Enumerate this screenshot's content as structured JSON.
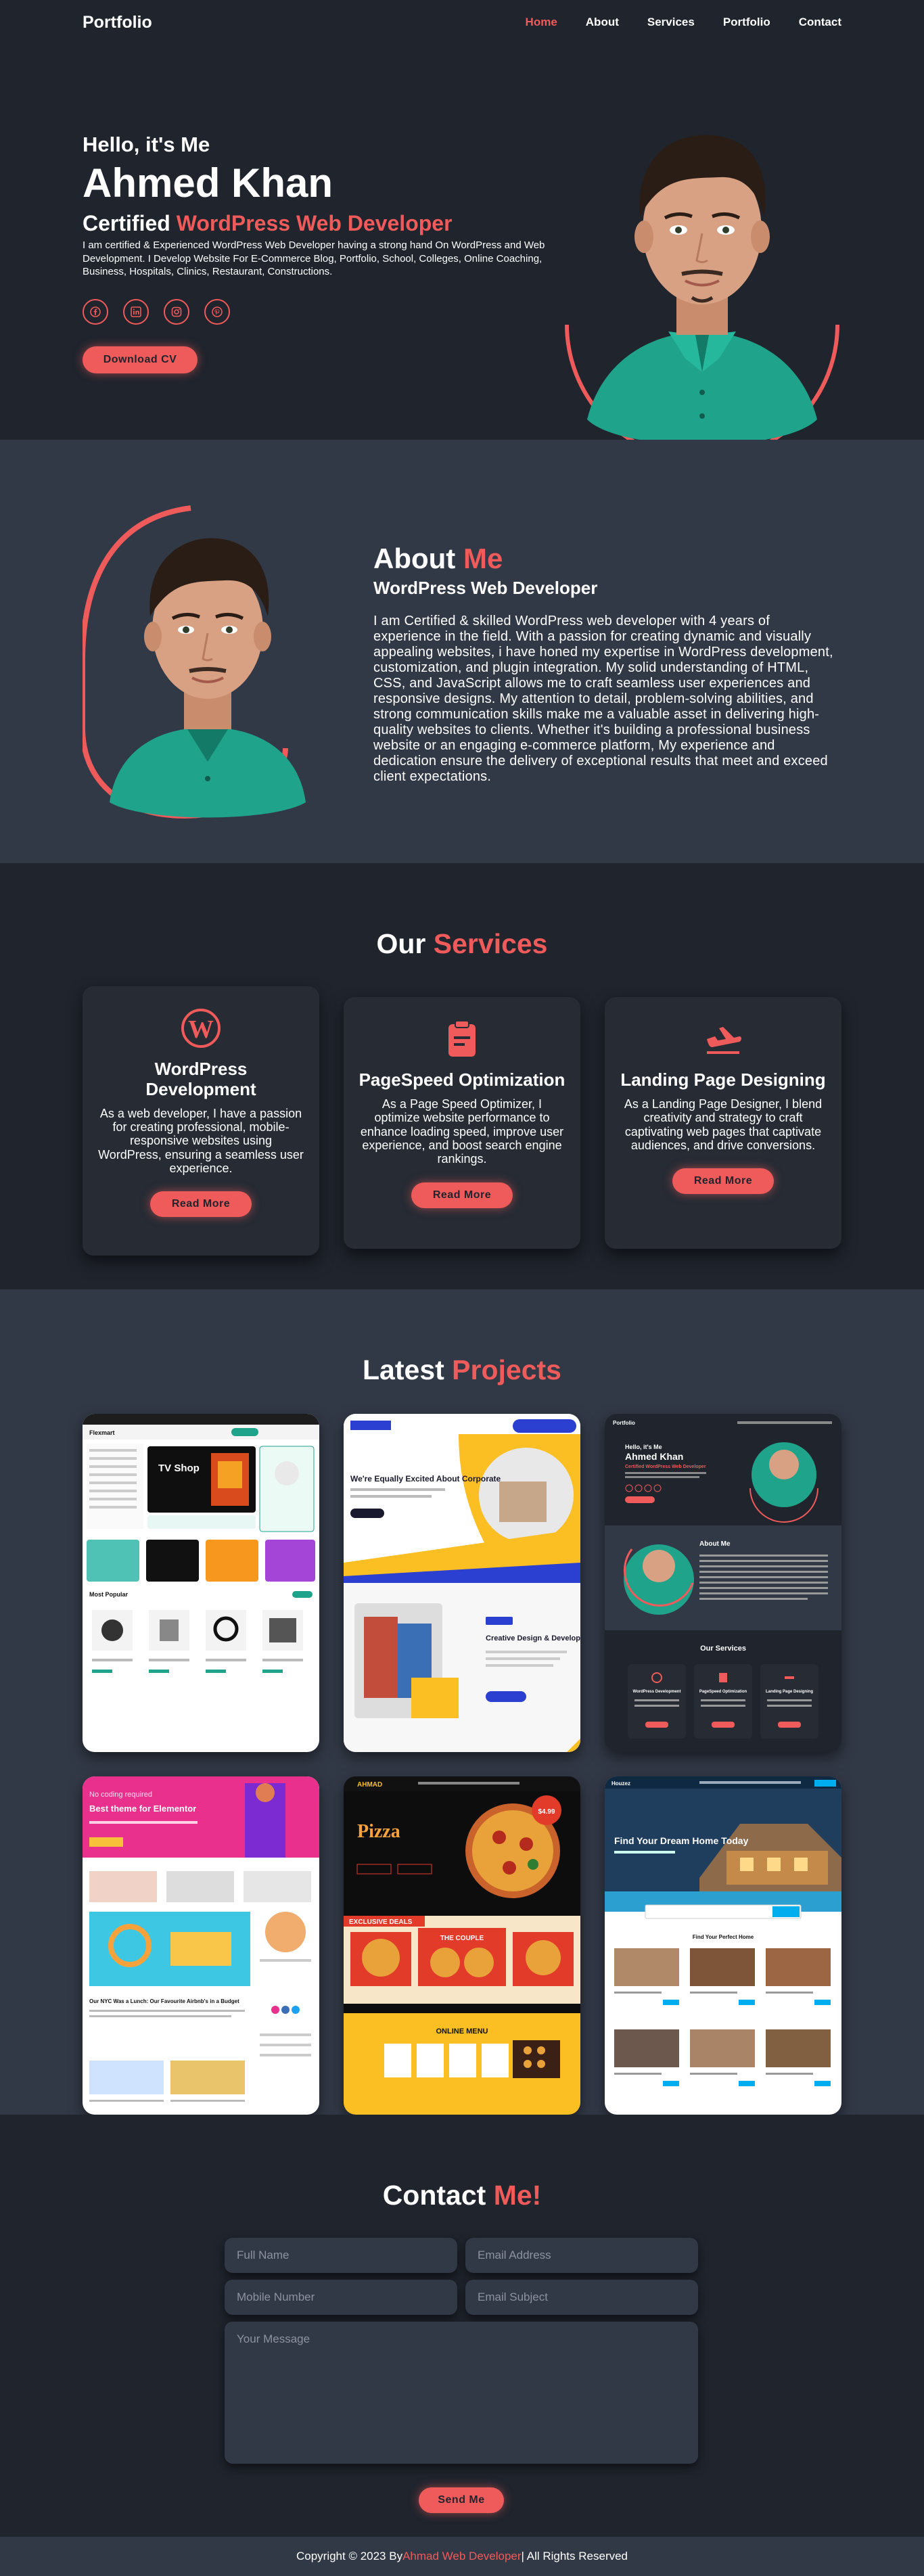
{
  "header": {
    "logo": "Portfolio",
    "nav": [
      "Home",
      "About",
      "Services",
      "Portfolio",
      "Contact"
    ]
  },
  "hero": {
    "hello": "Hello, it's Me",
    "name": "Ahmed Khan",
    "role_prefix": "Certified ",
    "role_accent": "WordPress Web Developer",
    "description": "I am certified & Experienced WordPress Web Developer having a strong hand On WordPress and Web Development. I Develop Website For E-Commerce Blog, Portfolio, School, Colleges, Online Coaching, Business, Hospitals, Clinics, Restaurant, Constructions.",
    "socials": [
      "facebook-icon",
      "linkedin-icon",
      "instagram-icon",
      "pinterest-icon"
    ],
    "cv_button": "Download CV"
  },
  "about": {
    "title_prefix": "About ",
    "title_accent": "Me",
    "subtitle": "WordPress Web Developer",
    "body": "I am Certified & skilled WordPress web developer with 4 years of experience in the field. With a passion for creating dynamic and visually appealing websites, i have honed my expertise in WordPress development, customization, and plugin integration. My solid understanding of HTML, CSS, and JavaScript allows me to craft seamless user experiences and responsive designs. My attention to detail, problem-solving abilities, and strong communication skills make me a valuable asset in delivering high-quality websites to clients. Whether it's building a professional business website or an engaging e-commerce platform, My experience and dedication ensure the delivery of exceptional results that meet and exceed client expectations."
  },
  "services": {
    "title_prefix": "Our ",
    "title_accent": "Services",
    "cards": [
      {
        "icon": "wordpress-icon",
        "title": "WordPress Development",
        "desc": "As a web developer, I have a passion for creating professional, mobile-responsive websites using WordPress, ensuring a seamless user experience.",
        "button": "Read More"
      },
      {
        "icon": "clipboard-icon",
        "title": "PageSpeed Optimization",
        "desc": "As a Page Speed Optimizer, I optimize website performance to enhance loading speed, improve user experience, and boost search engine rankings.",
        "button": "Read More"
      },
      {
        "icon": "airplane-icon",
        "title": "Landing Page Designing",
        "desc": "As a Landing Page Designer, I blend creativity and strategy to craft captivating web pages that captivate audiences, and drive conversions.",
        "button": "Read More"
      }
    ]
  },
  "projects": {
    "title_prefix": "Latest ",
    "title_accent": "Projects",
    "p1": {
      "brand": "Flexmart",
      "hero": "TV Shop",
      "section": "Most Popular"
    },
    "p2": {
      "hero": "We're Equally Excited About Corporate",
      "section": "Creative Design & Development"
    },
    "p3": {
      "logo": "Portfolio",
      "hello": "Hello, it's Me",
      "name": "Ahmed Khan",
      "role": "Certified WordPress Web Developer",
      "about": "About Me",
      "services": "Our Services",
      "cards": [
        "WordPress Development",
        "PageSpeed Optimization",
        "Landing Page Designing"
      ]
    },
    "p4": {
      "tag": "No coding required",
      "hero": "Best theme for Elementor",
      "post": "Our NYC Was a Lunch: Our Favourite Airbnb's in a Budget"
    },
    "p5": {
      "brand": "AHMAD",
      "hero": "Pizza",
      "price": "$4.99",
      "promo": "EXCLUSIVE DEALS",
      "pack": "THE COUPLE",
      "menu": "ONLINE MENU"
    },
    "p6": {
      "brand": "Houzez",
      "hero": "Find Your Dream Home Today",
      "section": "Find Your Perfect Home"
    }
  },
  "contact": {
    "title_prefix": "Contact ",
    "title_accent": "Me!",
    "full_name": "Full Name",
    "email": "Email Address",
    "mobile": "Mobile Number",
    "subject": "Email Subject",
    "message": "Your Message",
    "button": "Send Me"
  },
  "footer": {
    "prefix": "Copyright © 2023 By ",
    "accent": "Ahmad Web Developer",
    "suffix": " | All Rights Reserved"
  },
  "colors": {
    "accent": "#ef5a5a",
    "bg": "#1f242d",
    "bg_alt": "#323946"
  }
}
